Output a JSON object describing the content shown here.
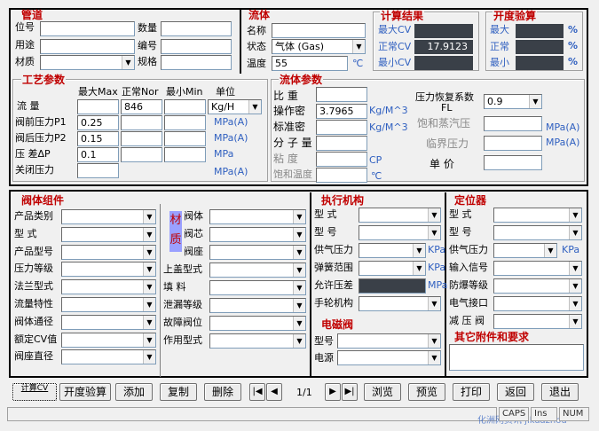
{
  "pipe": {
    "title": "管道",
    "pos_label": "位号",
    "use_label": "用途",
    "material_label": "材质",
    "qty_label": "数量",
    "code_label": "编号",
    "spec_label": "规格"
  },
  "fluid": {
    "title": "流体",
    "name_label": "名称",
    "state_label": "状态",
    "state_value": "气体 (Gas)",
    "temp_label": "温度",
    "temp_value": "55",
    "temp_unit": "℃"
  },
  "calc": {
    "title": "计算结果",
    "max_label": "最大CV",
    "norm_label": "正常CV",
    "min_label": "最小CV",
    "norm_value": "17.9123"
  },
  "open": {
    "title": "开度验算",
    "max_label": "最大",
    "norm_label": "正常",
    "min_label": "最小",
    "unit": "%"
  },
  "process": {
    "title": "工艺参数",
    "col_max": "最大Max",
    "col_nor": "正常Nor",
    "col_min": "最小Min",
    "col_unit": "单位",
    "rows": [
      {
        "label": "流  量",
        "max": "",
        "nor": "846",
        "min": "",
        "unit": "Kg/H"
      },
      {
        "label": "阀前压力P1",
        "max": "0.25",
        "unit": "MPa(A)"
      },
      {
        "label": "阀后压力P2",
        "max": "0.15",
        "unit": "MPa(A)"
      },
      {
        "label": "压  差ΔP",
        "max": "0.1",
        "unit": "MPa"
      },
      {
        "label": "关闭压力",
        "unit": "MPa(A)"
      }
    ]
  },
  "fluidparam": {
    "title": "流体参数",
    "density_label": "比  重",
    "op_density_label": "操作密",
    "op_density_value": "3.7965",
    "op_density_unit": "Kg/M^3",
    "std_density_label": "标准密",
    "std_density_unit": "Kg/M^3",
    "mol_label": "分 子 量",
    "visc_label": "粘  度",
    "visc_unit": "CP",
    "sat_temp_label": "饱和温度",
    "sat_temp_unit": "℃",
    "fl_label": "压力恢复系数",
    "fl_sub": "FL",
    "fl_value": "0.9",
    "sat_press_label": "饱和蒸汽压",
    "sat_press_unit": "MPa(A)",
    "crit_label": "临界压力",
    "crit_unit": "MPa(A)",
    "price_label": "单  价"
  },
  "body": {
    "title": "阀体组件",
    "labels": [
      "产品类别",
      "型  式",
      "产品型号",
      "压力等级",
      "法兰型式",
      "流量特性",
      "阀体通径",
      "额定CV值",
      "阀座直径"
    ]
  },
  "material": {
    "tag1": "材",
    "tag2": "质",
    "labels": [
      "阀体",
      "阀芯",
      "阀座"
    ],
    "labels2": [
      "上盖型式",
      "填  料",
      "泄漏等级",
      "故障阀位",
      "作用型式"
    ]
  },
  "actuator": {
    "title": "执行机构",
    "labels": [
      "型  式",
      "型  号",
      "供气压力",
      "弹簧范围",
      "允许压差",
      "手轮机构"
    ],
    "unit_kpa": "KPa",
    "unit_kpa2": "KPa",
    "unit_mpa": "MPa"
  },
  "solenoid": {
    "title": "电磁阀",
    "model_label": "型号",
    "power_label": "电源"
  },
  "positioner": {
    "title": "定位器",
    "labels": [
      "型  式",
      "型  号",
      "供气压力",
      "输入信号",
      "防爆等级",
      "电气接口",
      "减 压 阀"
    ],
    "unit": "KPa"
  },
  "other": {
    "title": "其它附件和要求"
  },
  "toolbar": {
    "calc_label": "计算CV",
    "open_label": "开度验算",
    "add_label": "添加",
    "copy_label": "复制",
    "delete_label": "删除",
    "page_label": "1/1",
    "browse_label": "浏览",
    "preview_label": "预览",
    "print_label": "打印",
    "back_label": "返回",
    "exit_label": "退出"
  },
  "statusbar": {
    "caps": "CAPS",
    "ins": "Ins",
    "num": "NUM",
    "watermark": "化洲网资讯 jikuazhou"
  },
  "colors": {
    "title_red": "#c00000",
    "unit_blue": "#3060c0",
    "readout_dark": "#3a4048"
  }
}
